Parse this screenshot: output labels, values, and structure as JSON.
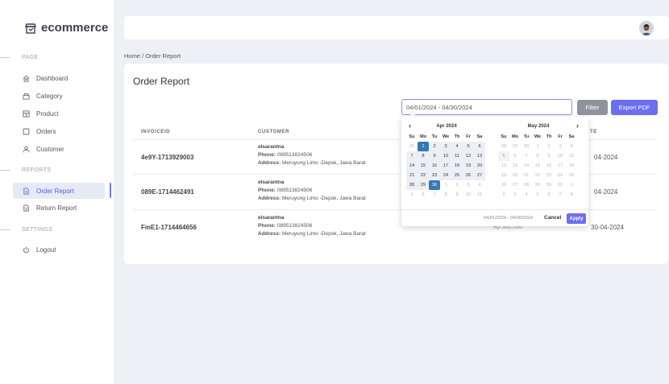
{
  "brand": {
    "name": "ecommerce"
  },
  "sidebar": {
    "sections": [
      {
        "label": "PAGE"
      },
      {
        "label": "REPORTS"
      },
      {
        "label": "SETTINGS"
      }
    ],
    "items": [
      {
        "label": "Dashboard",
        "icon": "home-icon"
      },
      {
        "label": "Category",
        "icon": "category-icon"
      },
      {
        "label": "Product",
        "icon": "product-icon"
      },
      {
        "label": "Orders",
        "icon": "orders-icon"
      },
      {
        "label": "Customer",
        "icon": "user-icon"
      },
      {
        "label": "Order Report",
        "icon": "report-icon",
        "active": true
      },
      {
        "label": "Return Report",
        "icon": "report-icon"
      },
      {
        "label": "Logout",
        "icon": "power-icon"
      }
    ]
  },
  "breadcrumb": {
    "home": "Home",
    "separator": "/",
    "current": "Order Report"
  },
  "page": {
    "title": "Order Report"
  },
  "filter": {
    "date_range": "04/01/2024 - 04/30/2024",
    "filter_label": "Filter",
    "export_label": "Export PDF"
  },
  "table": {
    "headers": {
      "invoice": "INVOICEID",
      "customer": "CUSTOMER",
      "date": "TE"
    },
    "rows": [
      {
        "invoice": "4e9Y-1713929003",
        "name": "elsarantna",
        "phone_label": "Phone:",
        "phone": "089513824506",
        "address_label": "Address:",
        "address": "Meruyung Limo -Depok, Jawa Barat",
        "date": "04-2024"
      },
      {
        "invoice": "089E-1714462491",
        "name": "elsarantna",
        "phone_label": "Phone:",
        "phone": "089513824506",
        "address_label": "Address:",
        "address": "Meruyung Limo -Depok, Jawa Barat",
        "date": "04-2024"
      },
      {
        "invoice": "FmE1-1714464656",
        "name": "elsarantna",
        "phone_label": "Phone:",
        "phone": "089513824506",
        "address_label": "Address:",
        "address": "Meruyung Limo -Depok, Jawa Barat",
        "date": "30-04-2024",
        "total": "Rp 300,000"
      }
    ]
  },
  "datepicker": {
    "prev": "‹",
    "next": "›",
    "weekdays": [
      "Su",
      "Mo",
      "Tu",
      "We",
      "Th",
      "Fr",
      "Sa"
    ],
    "left": {
      "title": "Apr 2024",
      "days": [
        {
          "d": "31",
          "s": "off"
        },
        {
          "d": "1",
          "s": "sel"
        },
        {
          "d": "2",
          "s": "in"
        },
        {
          "d": "3",
          "s": "in"
        },
        {
          "d": "4",
          "s": "in"
        },
        {
          "d": "5",
          "s": "in"
        },
        {
          "d": "6",
          "s": "in"
        },
        {
          "d": "7",
          "s": "in"
        },
        {
          "d": "8",
          "s": "in"
        },
        {
          "d": "9",
          "s": "in"
        },
        {
          "d": "10",
          "s": "in"
        },
        {
          "d": "11",
          "s": "in"
        },
        {
          "d": "12",
          "s": "in"
        },
        {
          "d": "13",
          "s": "in"
        },
        {
          "d": "14",
          "s": "in"
        },
        {
          "d": "15",
          "s": "in"
        },
        {
          "d": "16",
          "s": "in"
        },
        {
          "d": "17",
          "s": "in"
        },
        {
          "d": "18",
          "s": "in"
        },
        {
          "d": "19",
          "s": "in"
        },
        {
          "d": "20",
          "s": "in"
        },
        {
          "d": "21",
          "s": "in"
        },
        {
          "d": "22",
          "s": "in"
        },
        {
          "d": "23",
          "s": "in"
        },
        {
          "d": "24",
          "s": "in"
        },
        {
          "d": "25",
          "s": "in"
        },
        {
          "d": "26",
          "s": "in"
        },
        {
          "d": "27",
          "s": "in"
        },
        {
          "d": "28",
          "s": "in"
        },
        {
          "d": "29",
          "s": "in"
        },
        {
          "d": "30",
          "s": "sel"
        },
        {
          "d": "1",
          "s": "off"
        },
        {
          "d": "2",
          "s": "off"
        },
        {
          "d": "3",
          "s": "off"
        },
        {
          "d": "4",
          "s": "off"
        },
        {
          "d": "5",
          "s": "off"
        },
        {
          "d": "6",
          "s": "off"
        },
        {
          "d": "7",
          "s": "off"
        },
        {
          "d": "8",
          "s": "off"
        },
        {
          "d": "9",
          "s": "off"
        },
        {
          "d": "10",
          "s": "off"
        },
        {
          "d": "11",
          "s": "off"
        }
      ]
    },
    "right": {
      "title": "May 2024",
      "days": [
        {
          "d": "28",
          "s": "off"
        },
        {
          "d": "29",
          "s": "off"
        },
        {
          "d": "30",
          "s": "off"
        },
        {
          "d": "1",
          "s": "off"
        },
        {
          "d": "2",
          "s": "off"
        },
        {
          "d": "3",
          "s": "off"
        },
        {
          "d": "4",
          "s": "off"
        },
        {
          "d": "5",
          "s": "mr"
        },
        {
          "d": "6",
          "s": "off"
        },
        {
          "d": "7",
          "s": "off"
        },
        {
          "d": "8",
          "s": "off"
        },
        {
          "d": "9",
          "s": "off"
        },
        {
          "d": "10",
          "s": "off"
        },
        {
          "d": "11",
          "s": "off"
        },
        {
          "d": "12",
          "s": "off"
        },
        {
          "d": "13",
          "s": "off"
        },
        {
          "d": "14",
          "s": "off"
        },
        {
          "d": "15",
          "s": "off"
        },
        {
          "d": "16",
          "s": "off"
        },
        {
          "d": "17",
          "s": "off"
        },
        {
          "d": "18",
          "s": "off"
        },
        {
          "d": "19",
          "s": "off"
        },
        {
          "d": "20",
          "s": "off"
        },
        {
          "d": "21",
          "s": "off"
        },
        {
          "d": "22",
          "s": "off"
        },
        {
          "d": "23",
          "s": "off"
        },
        {
          "d": "24",
          "s": "off"
        },
        {
          "d": "25",
          "s": "off"
        },
        {
          "d": "26",
          "s": "off"
        },
        {
          "d": "27",
          "s": "off"
        },
        {
          "d": "28",
          "s": "off"
        },
        {
          "d": "29",
          "s": "off"
        },
        {
          "d": "30",
          "s": "off"
        },
        {
          "d": "31",
          "s": "off"
        },
        {
          "d": "1",
          "s": "off"
        },
        {
          "d": "2",
          "s": "off"
        },
        {
          "d": "3",
          "s": "off"
        },
        {
          "d": "4",
          "s": "off"
        },
        {
          "d": "5",
          "s": "off"
        },
        {
          "d": "6",
          "s": "off"
        },
        {
          "d": "7",
          "s": "off"
        },
        {
          "d": "8",
          "s": "off"
        }
      ]
    },
    "range_text": "04/01/2024 - 04/30/2024",
    "cancel": "Cancel",
    "apply": "Apply"
  },
  "colors": {
    "accent": "#6a6ff2",
    "selected_day": "#3478b8",
    "filter_button": "#8f949c"
  }
}
